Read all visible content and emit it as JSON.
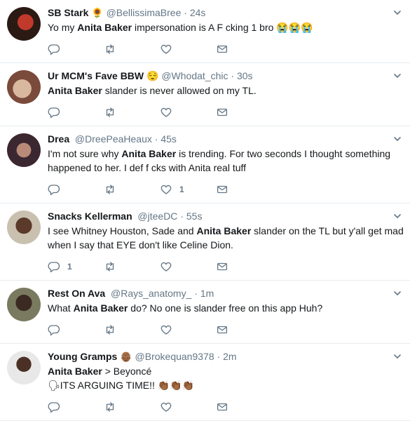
{
  "colors": {
    "text": "#14171a",
    "secondary": "#657786",
    "border": "#e6ecf0"
  },
  "tweets": [
    {
      "name": "SB Stark",
      "name_emoji": "🌻",
      "handle": "@BellissimaBree",
      "time": "24s",
      "text_pre": "Yo my ",
      "highlight": "Anita Baker",
      "text_post": " impersonation is A F cking 1 bro 😭😭😭",
      "line2": "",
      "reply_count": "",
      "like_count": ""
    },
    {
      "name": "Ur MCM's Fave BBW",
      "name_emoji": "😌",
      "handle": "@Whodat_chic",
      "time": "30s",
      "text_pre": "",
      "highlight": "Anita Baker",
      "text_post": " slander is never allowed on my TL.",
      "line2": "",
      "reply_count": "",
      "like_count": ""
    },
    {
      "name": "Drea",
      "name_emoji": "",
      "handle": "@DreePeaHeaux",
      "time": "45s",
      "text_pre": "I'm not sure why ",
      "highlight": "Anita Baker",
      "text_post": " is trending. For two seconds I thought something",
      "line2": "happened to her. I def f cks with Anita real tuff",
      "reply_count": "",
      "like_count": "1"
    },
    {
      "name": "Snacks Kellerman",
      "name_emoji": "",
      "handle": "@jteeDC",
      "time": "55s",
      "text_pre": "I see Whitney Houston, Sade and ",
      "highlight": "Anita Baker",
      "text_post": " slander on the TL but y'all get mad",
      "line2": "when I say that EYE don't like Celine Dion.",
      "reply_count": "1",
      "like_count": ""
    },
    {
      "name": "Rest On Ava",
      "name_emoji": "",
      "handle": "@Rays_anatomy_",
      "time": "1m",
      "text_pre": "What ",
      "highlight": "Anita Baker",
      "text_post": " do? No one is slander free on this app Huh?",
      "line2": "",
      "reply_count": "",
      "like_count": ""
    },
    {
      "name": "Young Gramps",
      "name_emoji": "👴🏾",
      "handle": "@Brokequan9378",
      "time": "2m",
      "text_pre": "",
      "highlight": "Anita Baker",
      "text_post": " > Beyoncé",
      "line2": "🗣ITS ARGUING TIME!! 👏🏾👏🏾👏🏾",
      "reply_count": "",
      "like_count": ""
    }
  ]
}
